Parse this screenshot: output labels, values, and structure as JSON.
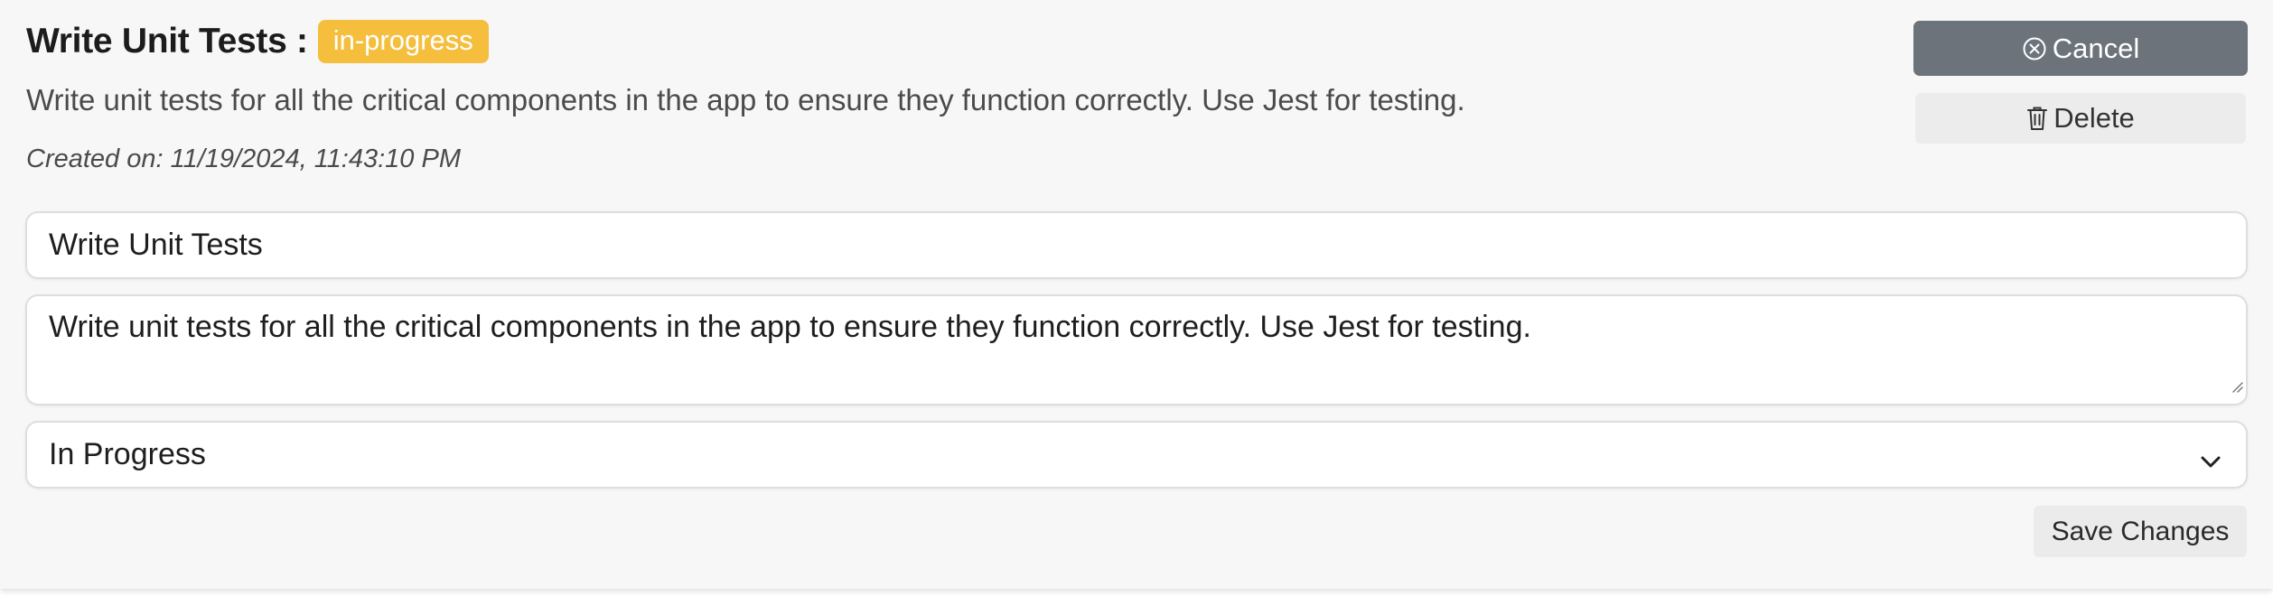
{
  "task": {
    "title": "Write Unit Tests :",
    "status_badge": "in-progress",
    "description": "Write unit tests for all the critical components in the app to ensure they function correctly. Use Jest for testing.",
    "created": "Created on: 11/19/2024, 11:43:10 PM"
  },
  "actions": {
    "cancel_label": "Cancel",
    "delete_label": "Delete",
    "save_label": "Save Changes"
  },
  "form": {
    "title_value": "Write Unit Tests",
    "description_value": "Write unit tests for all the critical components in the app to ensure they function correctly. Use Jest for testing.",
    "status_value": "In Progress"
  },
  "colors": {
    "badge": "#f5bf3d",
    "cancel_button": "#6c737b",
    "card_background": "#f7f7f7"
  },
  "icons": {
    "cancel": "x-circle-icon",
    "delete": "trash-icon",
    "select": "chevron-down-icon",
    "resize": "resize-handle-icon"
  }
}
